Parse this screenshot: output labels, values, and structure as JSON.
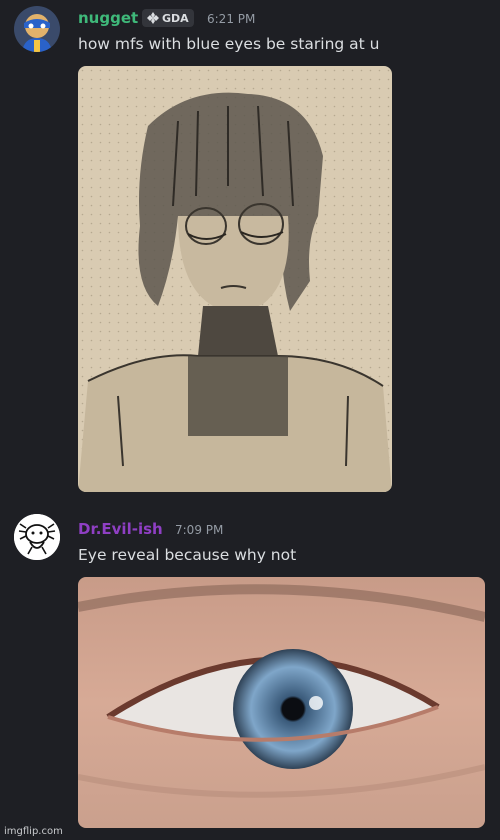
{
  "messages": [
    {
      "username": "nugget",
      "username_color": "#3fb97a",
      "tag": "GDA",
      "timestamp": "6:21 PM",
      "text": "how mfs with blue eyes be staring at u",
      "avatar_icon": "masked-hero-avatar",
      "attachment_icon": "pencil-sketch-image"
    },
    {
      "username": "Dr.Evil-ish",
      "username_color": "#8f3fc4",
      "timestamp": "7:09 PM",
      "text": "Eye reveal because why not",
      "avatar_icon": "axolotl-avatar",
      "attachment_icon": "blue-eye-photo"
    }
  ],
  "watermark": "imgflip.com"
}
